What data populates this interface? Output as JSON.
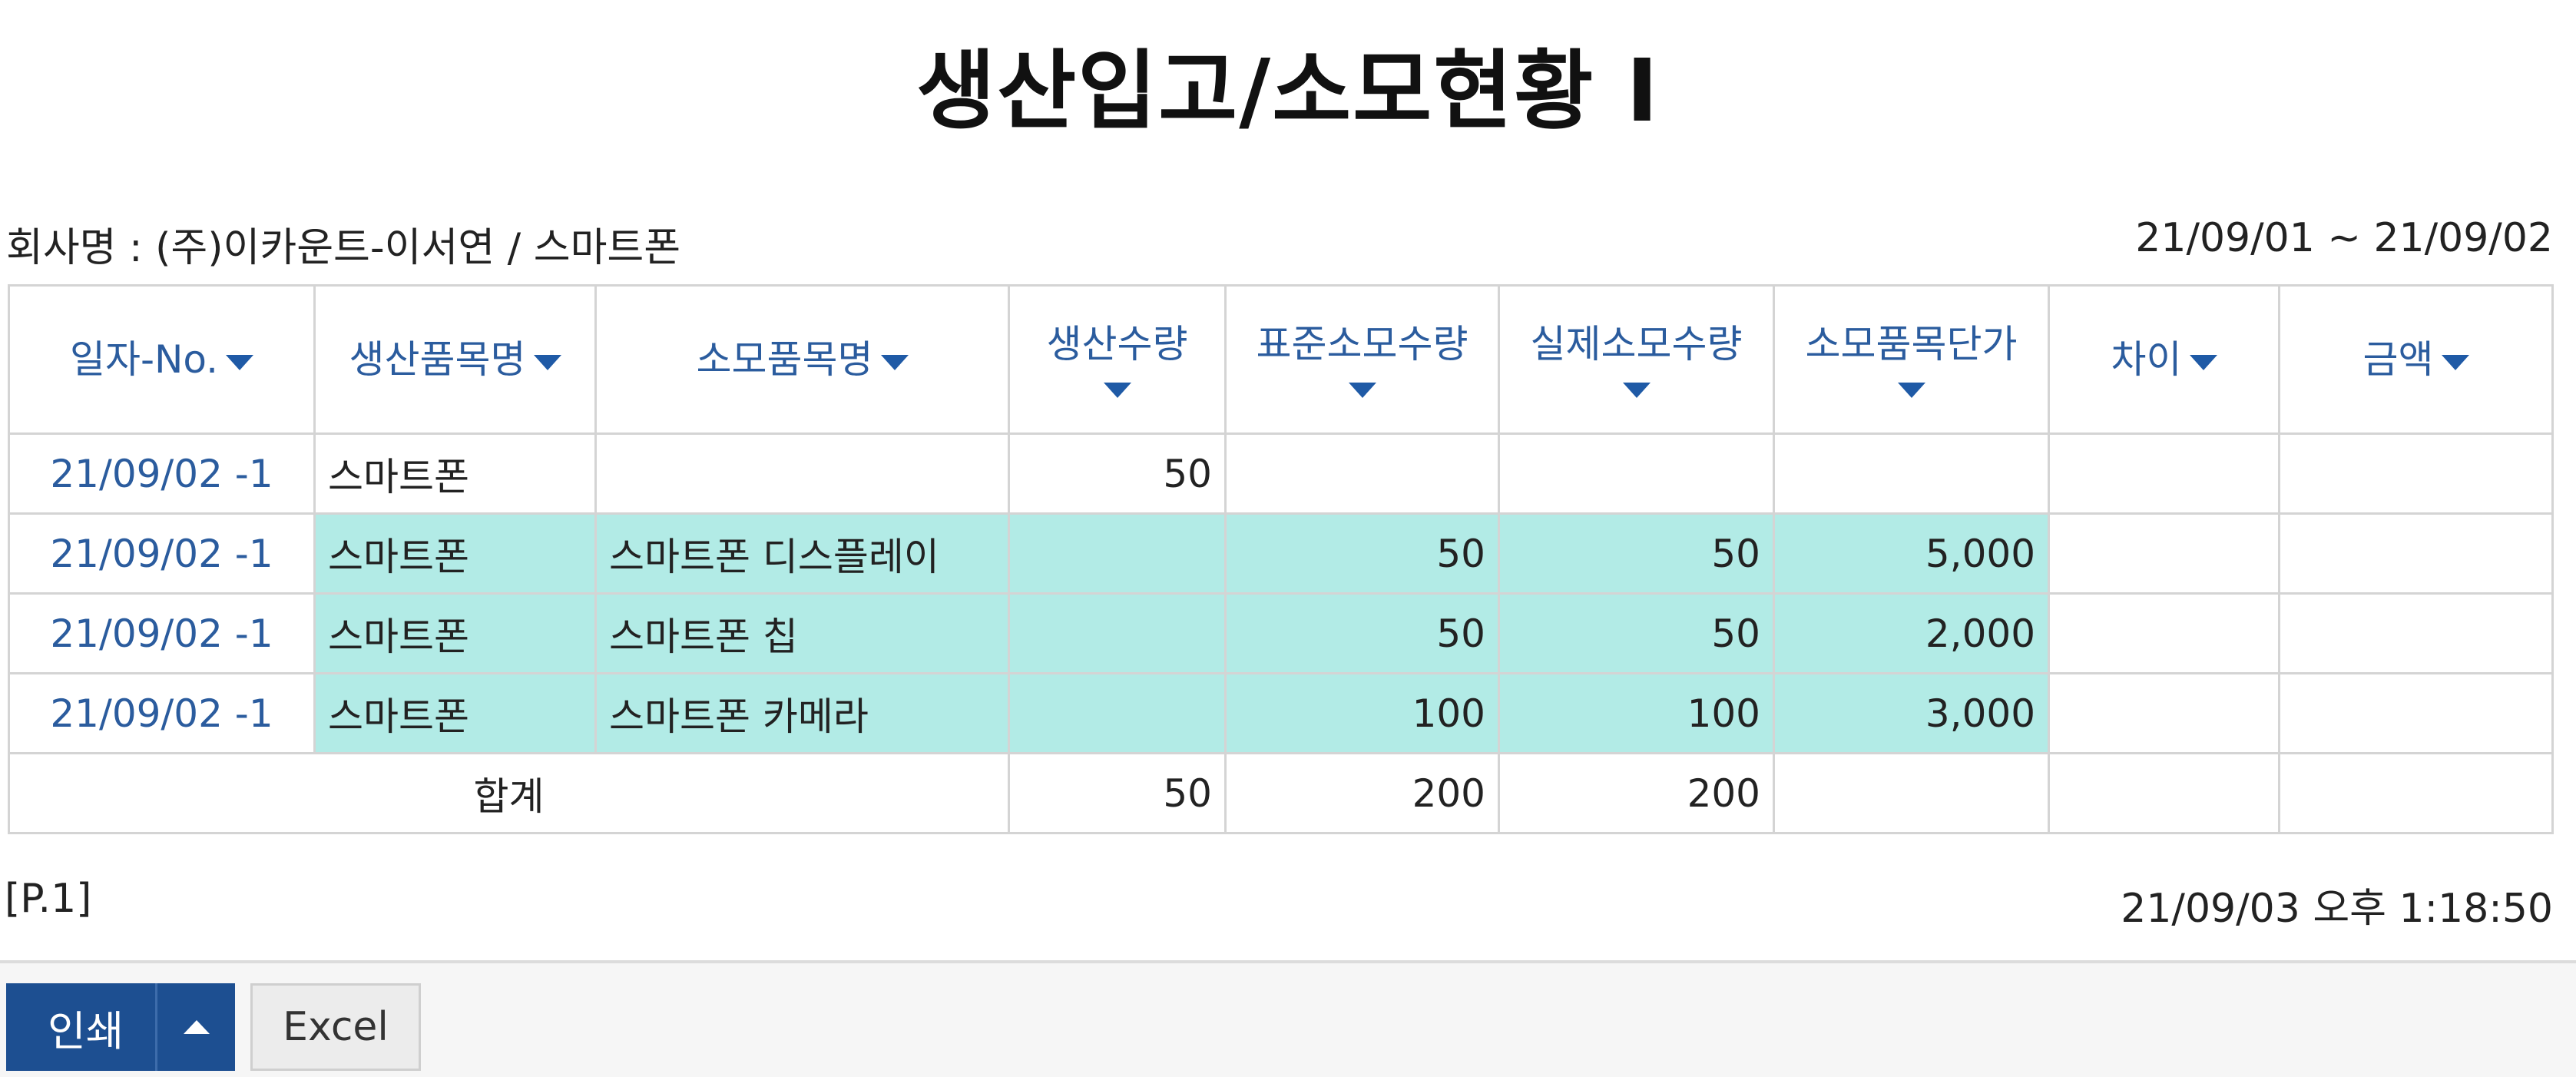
{
  "report": {
    "title": "생산입고/소모현황 I",
    "company": "회사명 : (주)이카운트-이서연 / 스마트폰",
    "date_range": "21/09/01 ~ 21/09/02",
    "page": "[P.1]",
    "printed_at": "21/09/03 오후 1:18:50"
  },
  "table": {
    "headers": [
      "일자-No.",
      "생산품목명",
      "소모품목명",
      "생산수량",
      "표준소모수량",
      "실제소모수량",
      "소모품목단가",
      "차이",
      "금액"
    ],
    "rows": [
      [
        "21/09/02 -1",
        "스마트폰",
        "",
        "50",
        "",
        "",
        "",
        "",
        ""
      ],
      [
        "21/09/02 -1",
        "스마트폰",
        "스마트폰 디스플레이",
        "",
        "50",
        "50",
        "5,000",
        "",
        ""
      ],
      [
        "21/09/02 -1",
        "스마트폰",
        "스마트폰 칩",
        "",
        "50",
        "50",
        "2,000",
        "",
        ""
      ],
      [
        "21/09/02 -1",
        "스마트폰",
        "스마트폰 카메라",
        "",
        "100",
        "100",
        "3,000",
        "",
        ""
      ]
    ],
    "total": [
      "합계",
      "50",
      "200",
      "200",
      "",
      "",
      ""
    ]
  },
  "buttons": {
    "print": "인쇄",
    "excel": "Excel"
  },
  "colors": {
    "header_text": "#2b5c9e",
    "highlight": "#b2ebe6",
    "print_button": "#1d4f91"
  }
}
